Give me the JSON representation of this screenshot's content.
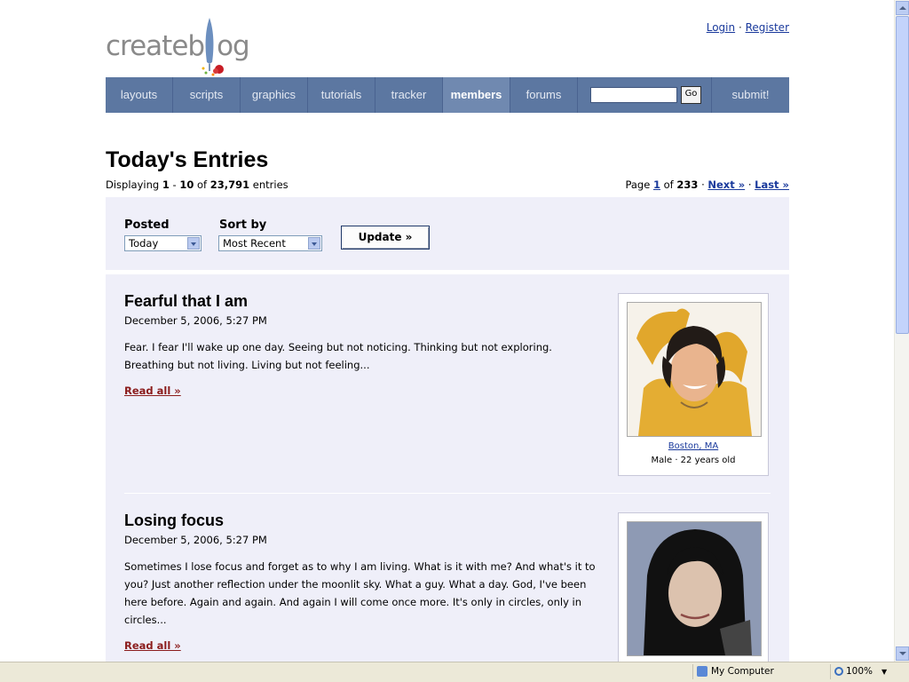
{
  "logo": {
    "text_prefix": "createb",
    "text_suffix": "og"
  },
  "auth": {
    "login": "Login",
    "separator": "·",
    "register": "Register"
  },
  "nav": {
    "items": [
      "layouts",
      "scripts",
      "graphics",
      "tutorials",
      "tracker",
      "members",
      "forums"
    ],
    "active": "members",
    "search_value": "",
    "go_label": "Go",
    "submit_label": "submit!"
  },
  "heading": {
    "title": "Today's Entries",
    "displaying_prefix": "Displaying",
    "range_start": "1",
    "range_dash": "-",
    "range_end": "10",
    "of_word": "of",
    "total": "23,791",
    "entries_word": "entries"
  },
  "pagination": {
    "page_word": "Page",
    "current": "1",
    "of_word": "of",
    "total_pages": "233",
    "next_label": "Next »",
    "last_label": "Last »",
    "separator": "·"
  },
  "filter": {
    "posted_label": "Posted",
    "posted_value": "Today",
    "sort_label": "Sort by",
    "sort_value": "Most Recent",
    "update_label": "Update »"
  },
  "entries": [
    {
      "title": "Fearful that I am",
      "date": "December 5, 2006, 5:27 PM",
      "body": "Fear. I fear I'll wake up one day. Seeing but not noticing. Thinking but not exploring. Breathing but not living. Living but not feeling...",
      "read_all": "Read all »",
      "location": "Boston, MA",
      "meta": "Male · 22 years old"
    },
    {
      "title": "Losing focus",
      "date": "December 5, 2006, 5:27 PM",
      "body": "Sometimes I lose focus and forget as to why I am living. What is it with me? And what's it to you? Just another reflection under the moonlit sky. What a guy. What a day. God, I've been here before. Again and again. And again I will come once more. It's only in circles, only in circles...",
      "read_all": "Read all »"
    }
  ],
  "status_bar": {
    "zone": "My Computer",
    "zoom": "100%"
  },
  "colors": {
    "nav_bg": "#5c77a1",
    "nav_active": "#7089b0",
    "panel_bg": "#efeff9",
    "link": "#1a3a9c",
    "read_all": "#8b1c1c"
  }
}
